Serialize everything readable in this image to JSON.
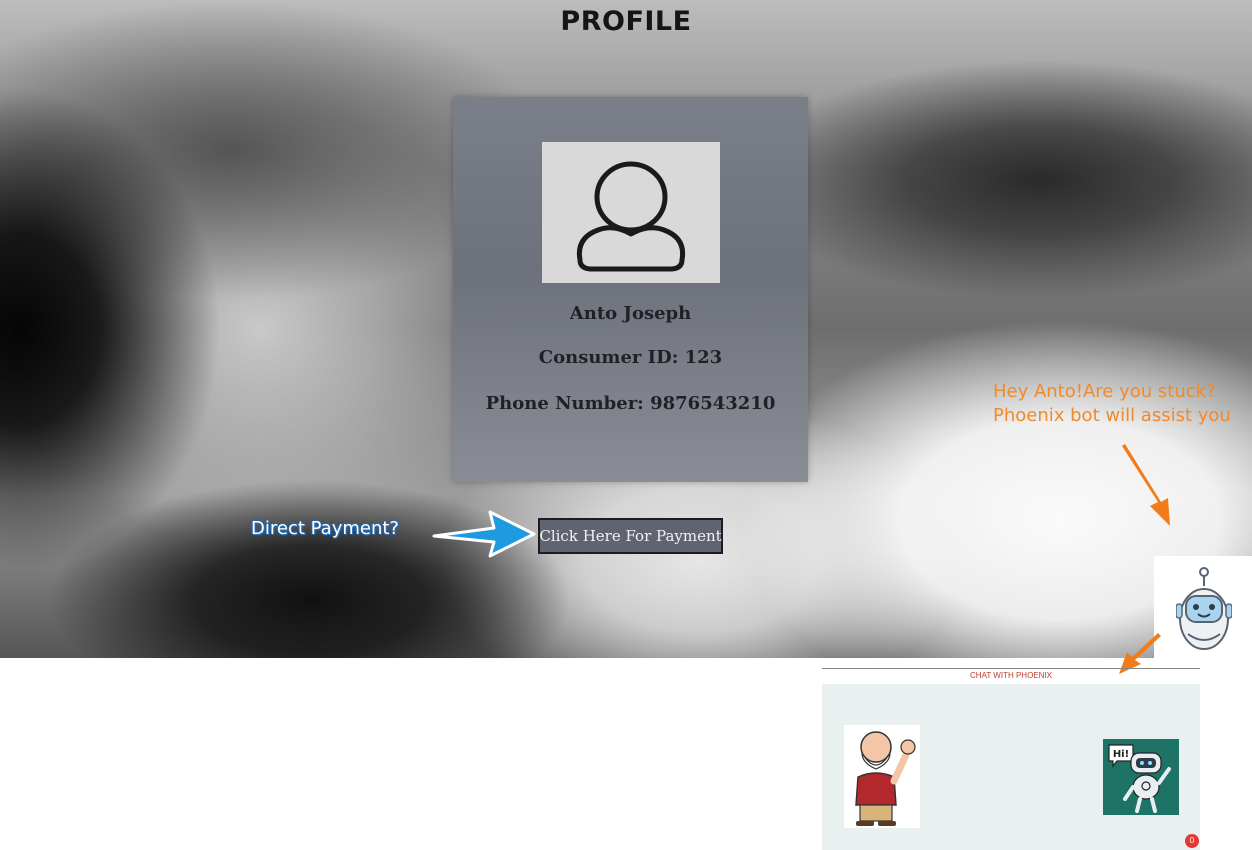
{
  "page": {
    "title": "PROFILE"
  },
  "profile": {
    "name": "Anto Joseph",
    "consumer_id": "Consumer ID: 123",
    "phone_number": "Phone Number: 9876543210"
  },
  "payment": {
    "hint_label": "Direct Payment?",
    "button_label": "Click Here For Payment"
  },
  "assistant": {
    "hint_line1": "Hey Anto!Are you stuck?",
    "hint_line2": "Phoenix bot will assist you",
    "chat_title": "CHAT WITH PHOENIX",
    "notification_count": "0",
    "hi_text": "Hi!"
  },
  "colors": {
    "hint_orange": "#f08a2a",
    "arrow_blue": "#1e9be0",
    "chat_bg": "#e8f1f0",
    "chat_title_red": "#c0392b",
    "bot_tile_green": "#1c7366"
  },
  "icons": {
    "avatar": "user-outline-icon",
    "launcher": "robot-head-icon"
  }
}
